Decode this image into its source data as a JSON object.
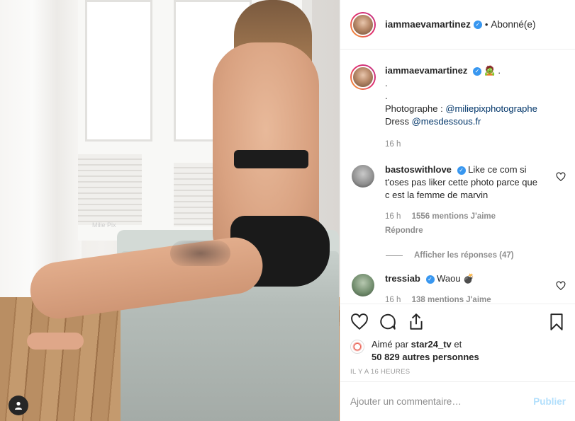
{
  "photo": {
    "watermark": "Milie Pix",
    "tag_icon": "user-tag-icon"
  },
  "header": {
    "username": "iammaevamartinez",
    "verified_icon": "verified-badge-icon",
    "separator": "•",
    "follow_state": "Abonné(e)"
  },
  "caption": {
    "username": "iammaevamartinez",
    "emoji": "🧟",
    "lines": [
      ".",
      ".",
      "."
    ],
    "photographer_label": "Photographe :",
    "photographer_handle": "@miliepixphotographe",
    "dress_label": "Dress",
    "dress_handle": "@mesdessous.fr",
    "time": "16 h"
  },
  "comments": [
    {
      "username": "bastoswithlove",
      "text": "Like ce com si t'oses pas liker cette photo parce que c est la femme de marvin",
      "time": "16 h",
      "likes": "1556 mentions J'aime",
      "reply": "Répondre",
      "view_replies": "Afficher les réponses (47)"
    },
    {
      "username": "tressiab",
      "text": "Waou 💣",
      "time": "16 h",
      "likes": "138 mentions J'aime"
    }
  ],
  "actions": {
    "like_icon": "heart-icon",
    "comment_icon": "comment-icon",
    "share_icon": "share-icon",
    "save_icon": "bookmark-icon"
  },
  "likes": {
    "liked_by_label": "Aimé par",
    "liked_by_user": "star24_tv",
    "and_label": "et",
    "others": "50 829 autres personnes"
  },
  "timestamp": "IL Y A 16 HEURES",
  "add_comment": {
    "placeholder": "Ajouter un commentaire…",
    "publish_label": "Publier"
  },
  "colors": {
    "verified": "#3897f0",
    "link": "#003569",
    "muted": "#8e8e8e",
    "publish_disabled": "#b2dffc"
  }
}
